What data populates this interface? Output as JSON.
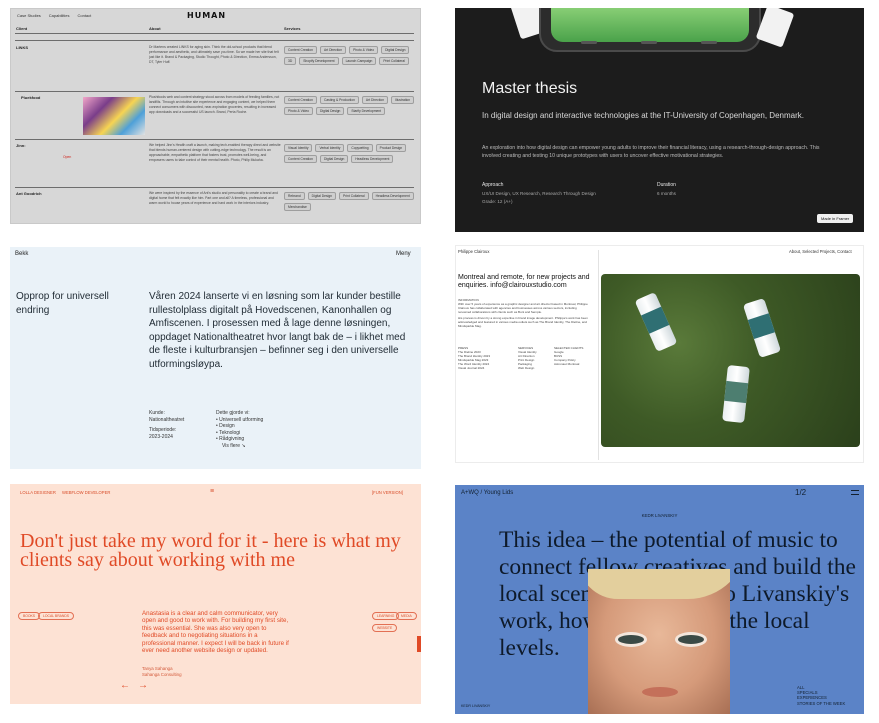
{
  "human": {
    "nav": [
      "Case Studies",
      "Capabilities",
      "Contact"
    ],
    "logo": "HUMAN",
    "headers": {
      "client": "Client",
      "about": "About",
      "services": "Services"
    },
    "rows": [
      {
        "client": "LINKS",
        "about": "Dr Martens created LINKS for aging skin. Think the old-school products that blend performance and aesthetic, and ultimately save you time. So we made her site that felt just like it. Brand & Packaging, Studio Thought, Photo & Direction, Emma Andersson, DT, Tyler Huff.",
        "services": [
          "Content Creation",
          "Art Direction",
          "Photo & Video",
          "Digital Design",
          "3D",
          "Shopify Development",
          "Launch Campaign",
          "Print Collateral"
        ]
      },
      {
        "client": "Pluekfood",
        "about": "Plushfoods web and content strategy stood across from models of feeding families, not landfills. Through an intuitive site experience and engaging content, we helped them connect consumers with discounted, near-expiration groceries, resulting in increased app downloads and a successful US launch. Brand, Perta Roche.",
        "services": [
          "Content Creation",
          "Casting & Production",
          "Art Direction",
          "Illustration",
          "Photo & Video",
          "Digital Design",
          "Starify Development"
        ]
      },
      {
        "client": "Jinn:",
        "about": "We helped Jinn's Health craft a launch, making tech-enabled therapy direct and website that blends human-centered design with cutting-edge technology. The result is an approachable, empathetic platform that fosters trust, promotes well-being, and empowers users to take control of their mental health. Photo, Philip Mukaha.",
        "services": [
          "Visual Identity",
          "Verbal Identity",
          "Copywriting",
          "Product Design",
          "Content Creation",
          "Digital Design",
          "Headless Development"
        ]
      },
      {
        "client": "Ant Goodrich",
        "about": "We were inspired by the essence of Ant's studio and personality to create a brand and digital home that felt exactly like him. Part one and all? A timeless, professional and warm world to house years of experience and hard work in the interiors industry.",
        "services": [
          "Rebrand",
          "Digital Design",
          "Print Collateral",
          "Headless Development",
          "Merchandise"
        ]
      }
    ],
    "open_label": "Open"
  },
  "thesis": {
    "title": "Master thesis",
    "subtitle": "In digital design and interactive technologies at the IT-University of Copenhagen, Denmark.",
    "description": "An exploration into how digital design can empower young adults to improve their financial literacy, using a research-through-design approach. This involved creating and testing 10 unique prototypes with users to uncover effective motivational strategies.",
    "approach_label": "Approach",
    "approach_value": "UX/UI Design, UX Research, Research Through Design",
    "grade": "Grade: 12 (A+)",
    "duration_label": "Duration",
    "duration_value": "6 months",
    "badge": "Made in Framer"
  },
  "bekk": {
    "brand": "Bekk",
    "menu": "Meny",
    "left_heading": "Opprop for universell endring",
    "body": "Våren 2024 lanserte vi en løsning som lar kunder bestille rullestolplass digitalt på Hovedscenen, Kanonhallen og Amfiscenen. I prosessen med å lage denne løsningen, oppdaget Nationaltheatret hvor langt bak de – i likhet med de fleste i kulturbransjen – befinner seg i den universelle utformingsløypa.",
    "kunde_label": "Kunde:",
    "kunde_value": "Nationaltheatret",
    "periode_label": "Tidsperiode:",
    "periode_value": "2023-2024",
    "done_label": "Dette gjorde vi:",
    "done_items": [
      "Universell utforming",
      "Design",
      "Teknologi",
      "Rådgivning"
    ],
    "more": "Vis flere ↘"
  },
  "philippe": {
    "name": "Philippe Clairoux",
    "nav": "About, Selected Projects, Contact",
    "headline": "Montreal and remote, for new projects and enquiries. info@clairouxstudio.com",
    "intro_label": "INFORMATION",
    "intro": "With over 5 years of experience as a graphic designer and art director based in Montreal, Philippe Clairoux has collaborated with agencies and businesses across various sectors, including renowned collaborations with clients such as Bunt and Semple.",
    "intro2": "His process is driven by a strong expertise in brand image development. Philippe's work has been acknowledged and featured in various media outlets such as The Brand Identity, The Dieline, and Mindsparkle Mag.",
    "cols": [
      {
        "label": "PRESS",
        "items": [
          "The Dieline 2023",
          "The Brand Identity 2023",
          "Mindsparkle Mag 2023",
          "The Word Identity 2024",
          "Visual Journal 2024"
        ]
      },
      {
        "label": "SERVICES",
        "items": [
          "Visual Identity",
          "Art Direction",
          "Print Design",
          "Packaging",
          "Web Design"
        ]
      },
      {
        "label": "SELECTED CLIENTS",
        "items": [
          "Google",
          "BUSS",
          "Company Policy",
          "Astronaut Montreal"
        ]
      }
    ]
  },
  "clients": {
    "nav_left": "LOLLA DESIGNER",
    "nav_mid": "WEBFLOW DEVELOPER",
    "nav_right": "[FUN VERSION]",
    "heading": "Don't just take my word for it - here is what my clients say about working with me",
    "quote": "Anastasia is a clear and calm communicator, very open and good to work with. For building my first site, this was essential. She was also very open to feedback and to negotiating situations in a professional manner. I expect I will be back in future if ever need another website design or updated.",
    "author_name": "Tanya Sahanga",
    "author_company": "Sahanga Consulting",
    "pills_left": [
      "BOOKS",
      "LOCAL BRANDS"
    ],
    "pills_right": [
      "LEARNING",
      "MEDIA",
      "WEBSITE"
    ],
    "prev": "←",
    "next": "→"
  },
  "livanskiy": {
    "nav_left": "A+WQ / Young Lids",
    "nav_right": "1/2",
    "label": "KEDR LIVANSKIY",
    "body": "This idea – the potential of music to connect fellow creatives and build the local scene – is central to Livanskiy's work, however far from the local levels.",
    "right_block": [
      "ALL",
      "SPECIALS",
      "EXPERIENCES",
      "STORIES OF THE WEEK"
    ],
    "footer": "KEDR LIVANSKIY"
  }
}
